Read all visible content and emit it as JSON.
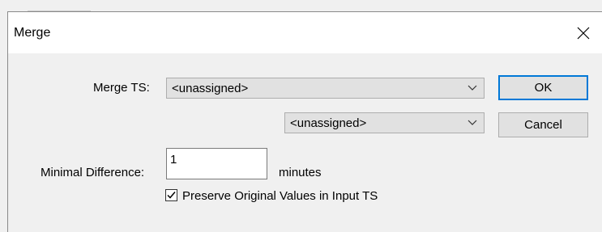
{
  "window": {
    "title": "Merge"
  },
  "form": {
    "merge_ts_label": "Merge TS:",
    "merge_ts_primary_value": "<unassigned>",
    "merge_ts_secondary_value": "<unassigned>",
    "min_diff_label": "Minimal Difference:",
    "min_diff_value": "1",
    "min_diff_unit": "minutes",
    "preserve_label": "Preserve Original Values in Input TS",
    "preserve_checked": true
  },
  "buttons": {
    "ok": "OK",
    "cancel": "Cancel"
  },
  "icons": {
    "close": "close-icon",
    "dropdown": "chevron-down-icon",
    "check": "check-icon"
  },
  "colors": {
    "accent": "#0078d7",
    "titlebar": "#ffffff",
    "body": "#f0f0f0"
  }
}
